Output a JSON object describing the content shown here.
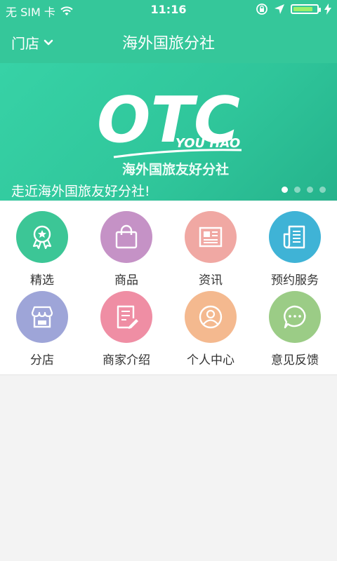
{
  "status": {
    "carrier": "无 SIM 卡",
    "time": "11:16",
    "battery_level": 0.85
  },
  "nav": {
    "store_label": "门店",
    "title": "海外国旅分社"
  },
  "banner": {
    "logo_main": "OTC",
    "logo_sub": "YOU HAO",
    "logo_name": "海外国旅友好分社",
    "caption": "走近海外国旅友好分社!",
    "page_count": 4,
    "active_page": 1
  },
  "menu": [
    {
      "label": "精选",
      "icon": "award-icon",
      "color": "#3cc696"
    },
    {
      "label": "商品",
      "icon": "shopping-bag-icon",
      "color": "#c592c6"
    },
    {
      "label": "资讯",
      "icon": "newspaper-icon",
      "color": "#f0a8a3"
    },
    {
      "label": "预约服务",
      "icon": "document-icon",
      "color": "#3fb3d6"
    },
    {
      "label": "分店",
      "icon": "store-icon",
      "color": "#9ea5d8"
    },
    {
      "label": "商家介绍",
      "icon": "edit-document-icon",
      "color": "#ef8ea4"
    },
    {
      "label": "个人中心",
      "icon": "user-icon",
      "color": "#f4b98f"
    },
    {
      "label": "意见反馈",
      "icon": "chat-bubble-icon",
      "color": "#9bcc86"
    }
  ]
}
